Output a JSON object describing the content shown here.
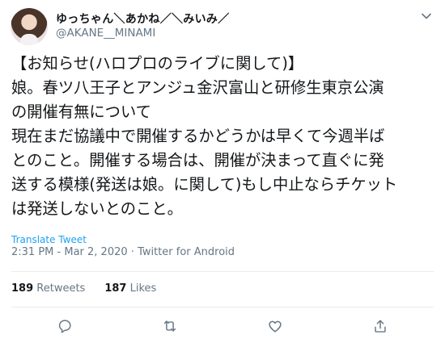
{
  "user": {
    "display_name": "ゆっちゃん＼あかね／＼みいみ／",
    "handle": "@AKANE__MINAMI"
  },
  "tweet": {
    "lines": [
      "【お知らせ(ハロプロのライブに関して)】",
      "娘。春ツ八王子とアンジュ金沢富山と研修生東京公演",
      "の開催有無について",
      "現在まだ協議中で開催するかどうかは早くて今週半ば",
      "とのこと。開催する場合は、開催が決まって直ぐに発",
      "送する模様(発送は娘。に関して)もし中止ならチケット",
      "は発送しないとのこと。"
    ],
    "translate_label": "Translate Tweet",
    "time": "2:31 PM",
    "date": "Mar 2, 2020",
    "separator": "·",
    "source": "Twitter for Android"
  },
  "stats": {
    "retweets_count": "189",
    "retweets_label": "Retweets",
    "likes_count": "187",
    "likes_label": "Likes"
  },
  "actions": {
    "icons": [
      "reply-icon",
      "retweet-icon",
      "like-icon",
      "share-icon"
    ]
  },
  "colors": {
    "accent": "#1da1f2",
    "muted": "#657786",
    "text": "#14171a",
    "divider": "#e6ecf0"
  }
}
